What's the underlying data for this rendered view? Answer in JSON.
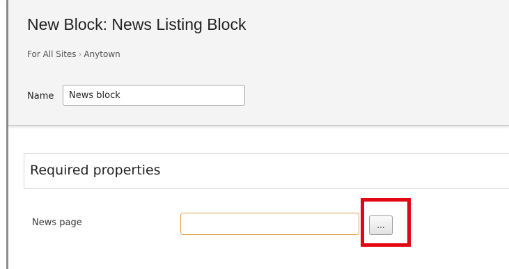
{
  "header": {
    "title": "New Block: News Listing Block",
    "breadcrumb": {
      "items": [
        "For All Sites",
        "Anytown"
      ],
      "separator": "›"
    },
    "name_field": {
      "label": "Name",
      "value": "News block"
    }
  },
  "section": {
    "title": "Required properties"
  },
  "fields": {
    "news_page": {
      "label": "News page",
      "value": "",
      "browse_label": "..."
    }
  },
  "colors": {
    "highlight": "#e30613",
    "input_focus_border": "#e3a24a"
  }
}
